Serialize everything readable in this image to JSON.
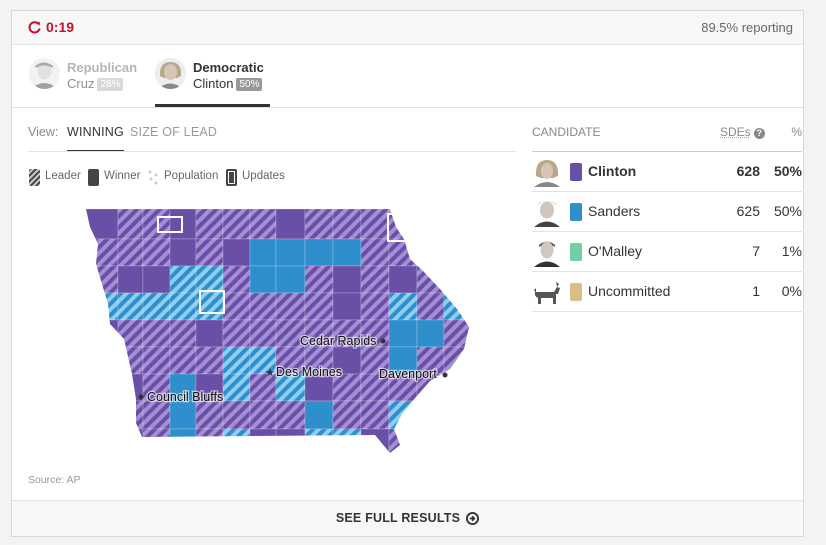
{
  "header": {
    "timer": "0:19",
    "reporting": "89.5% reporting",
    "colors": {
      "timer": "#c8102e"
    }
  },
  "tabs": [
    {
      "party": "Republican",
      "candidate": "Cruz",
      "pct": "28%"
    },
    {
      "party": "Democratic",
      "candidate": "Clinton",
      "pct": "50%"
    }
  ],
  "view": {
    "label": "View:",
    "options": [
      "WINNING",
      "SIZE OF LEAD"
    ],
    "selected": "WINNING"
  },
  "legend": [
    {
      "label": "Leader",
      "icon": "striped-swatch-icon"
    },
    {
      "label": "Winner",
      "icon": "solid-swatch-icon"
    },
    {
      "label": "Population",
      "icon": "population-dots-icon"
    },
    {
      "label": "Updates",
      "icon": "outlined-swatch-icon"
    }
  ],
  "map": {
    "cities": [
      "Cedar Rapids",
      "Des Moines",
      "Davenport",
      "Council Bluffs"
    ],
    "colors": {
      "clinton": "#6a4fa6",
      "clinton_light": "#a48fd6",
      "sanders": "#2f8fcd",
      "sanders_light": "#8fcef0"
    }
  },
  "source": "Source: AP",
  "results": {
    "headers": {
      "candidate": "CANDIDATE",
      "sdes": "SDEs",
      "help": "?",
      "pct": "%"
    },
    "rows": [
      {
        "name": "Clinton",
        "sdes": "628",
        "pct": "50%",
        "color": "#6a4fa6",
        "leader": true
      },
      {
        "name": "Sanders",
        "sdes": "625",
        "pct": "50%",
        "color": "#2f8fcd",
        "leader": false
      },
      {
        "name": "O'Malley",
        "sdes": "7",
        "pct": "1%",
        "color": "#6fcfa5",
        "leader": false
      },
      {
        "name": "Uncommitted",
        "sdes": "1",
        "pct": "0%",
        "color": "#d8bf8a",
        "leader": false,
        "icon": "donkey-icon"
      }
    ]
  },
  "footer": {
    "cta": "SEE FULL RESULTS"
  }
}
